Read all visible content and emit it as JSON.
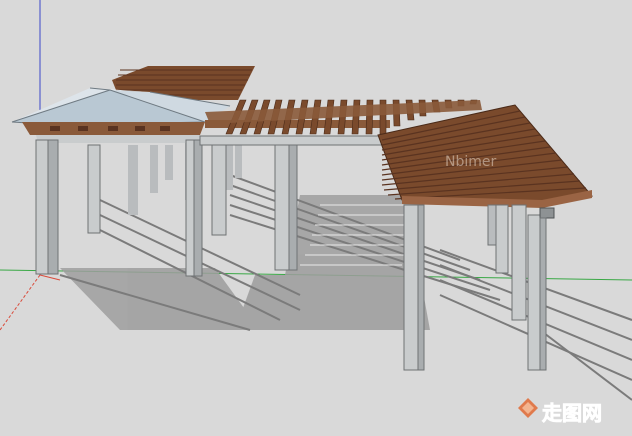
{
  "scene": {
    "description_free": true,
    "watermarks": {
      "center_text": "Nbimer",
      "corner_text": "走图网"
    },
    "colors": {
      "background": "#d9d9d9",
      "wood": "#7a4a2c",
      "wood_dark": "#5a3320",
      "wood_light": "#9a6444",
      "post": "#c9cccd",
      "post_shadow": "#8e9294",
      "roof_glass": "#b9c8d3",
      "shadow": "#9a9a9a",
      "axis_red": "#d94b3b",
      "axis_green": "#39a845",
      "axis_blue": "#3b48c9"
    }
  }
}
